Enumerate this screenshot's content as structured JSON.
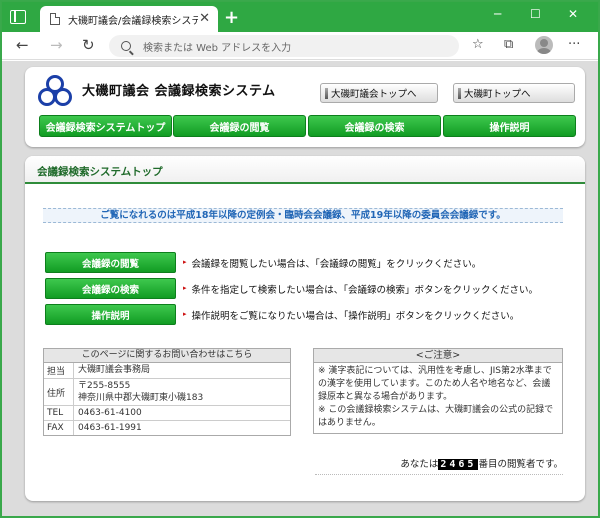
{
  "browser": {
    "tab_title": "大磯町議会/会議録検索システム",
    "tab_close": "✕",
    "new_tab": "+",
    "minimize": "─",
    "maximize": "☐",
    "close": "✕",
    "address_placeholder": "検索または Web アドレスを入力",
    "back": "←",
    "forward": "→",
    "reload": "↻",
    "favorites": "☆",
    "collections": "⧉",
    "more": "···"
  },
  "header": {
    "site_title": "大磯町議会  会議録検索システム",
    "link_council_top": "大磯町議会トップへ",
    "link_town_top": "大磯町トップへ"
  },
  "nav": [
    {
      "label": "会議録検索システムトップ"
    },
    {
      "label": "会議録の閲覧"
    },
    {
      "label": "会議録の検索"
    },
    {
      "label": "操作説明"
    }
  ],
  "main": {
    "title": "会議録検索システムトップ",
    "notice": "ご覧になれるのは平成18年以降の定例会・臨時会会議録、平成19年以降の委員会会議録です。",
    "actions": [
      {
        "button": "会議録の閲覧",
        "desc": "会議録を閲覧したい場合は、「会議録の閲覧」をクリックください。"
      },
      {
        "button": "会議録の検索",
        "desc": "条件を指定して検索したい場合は、「会議録の検索」ボタンをクリックください。"
      },
      {
        "button": "操作説明",
        "desc": "操作説明をご覧になりたい場合は、「操作説明」ボタンをクリックください。"
      }
    ]
  },
  "contact": {
    "heading": "このページに関するお問い合わせはこちら",
    "rows": [
      {
        "label": "担当",
        "value": "大磯町議会事務局"
      },
      {
        "label": "住所",
        "value": "〒255-8555",
        "value2": "神奈川県中郡大磯町東小磯183"
      },
      {
        "label": "TEL",
        "value": "0463-61-4100"
      },
      {
        "label": "FAX",
        "value": "0463-61-1991"
      }
    ]
  },
  "caution": {
    "heading": "<ご注意>",
    "line1": "※ 漢字表記については、汎用性を考慮し、JIS第2水準までの漢字を使用しています。このため人名や地名など、会議録原本と異なる場合があります。",
    "line2": "※ この会議録検索システムは、大磯町議会の公式の記録ではありません。"
  },
  "counter": {
    "prefix": "あなたは",
    "count": "2465",
    "suffix": "番目の閲覧者です。"
  },
  "colors": {
    "accent_green": "#1fae33",
    "notice_blue": "#2166b6",
    "logo_blue": "#1b3fa8"
  }
}
